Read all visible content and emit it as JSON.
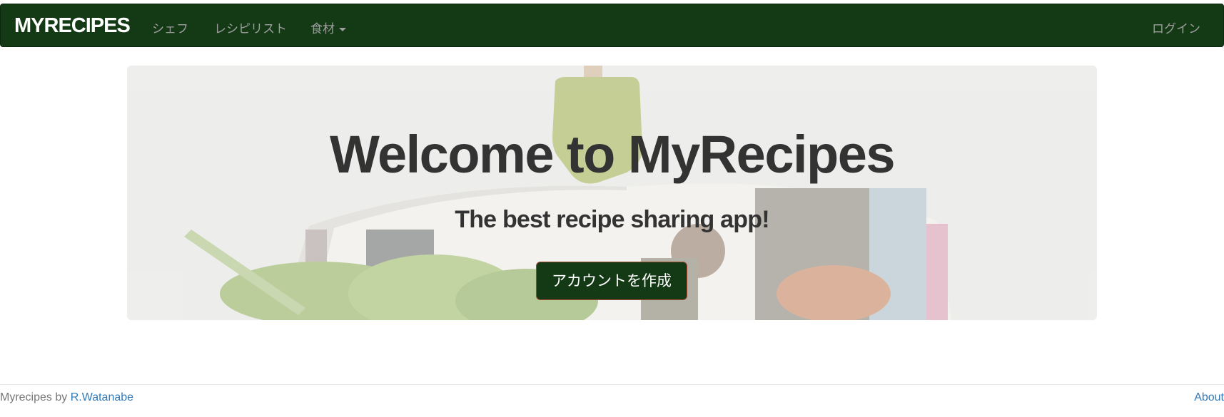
{
  "navbar": {
    "brand": "MYRECIPES",
    "links": [
      "シェフ",
      "レシピリスト",
      "食材"
    ],
    "login": "ログイン",
    "background": "#133915"
  },
  "hero": {
    "title": "Welcome to MyRecipes",
    "subtitle": "The best recipe sharing app!",
    "cta": "アカウントを作成"
  },
  "footer": {
    "prefix": "Myrecipes by",
    "author": "R.Watanabe",
    "about": "About"
  },
  "colors": {
    "nav_bg": "#133915",
    "link": "#337ab7",
    "text": "#333333"
  },
  "icons": {
    "dropdown": "caret-down-icon"
  }
}
